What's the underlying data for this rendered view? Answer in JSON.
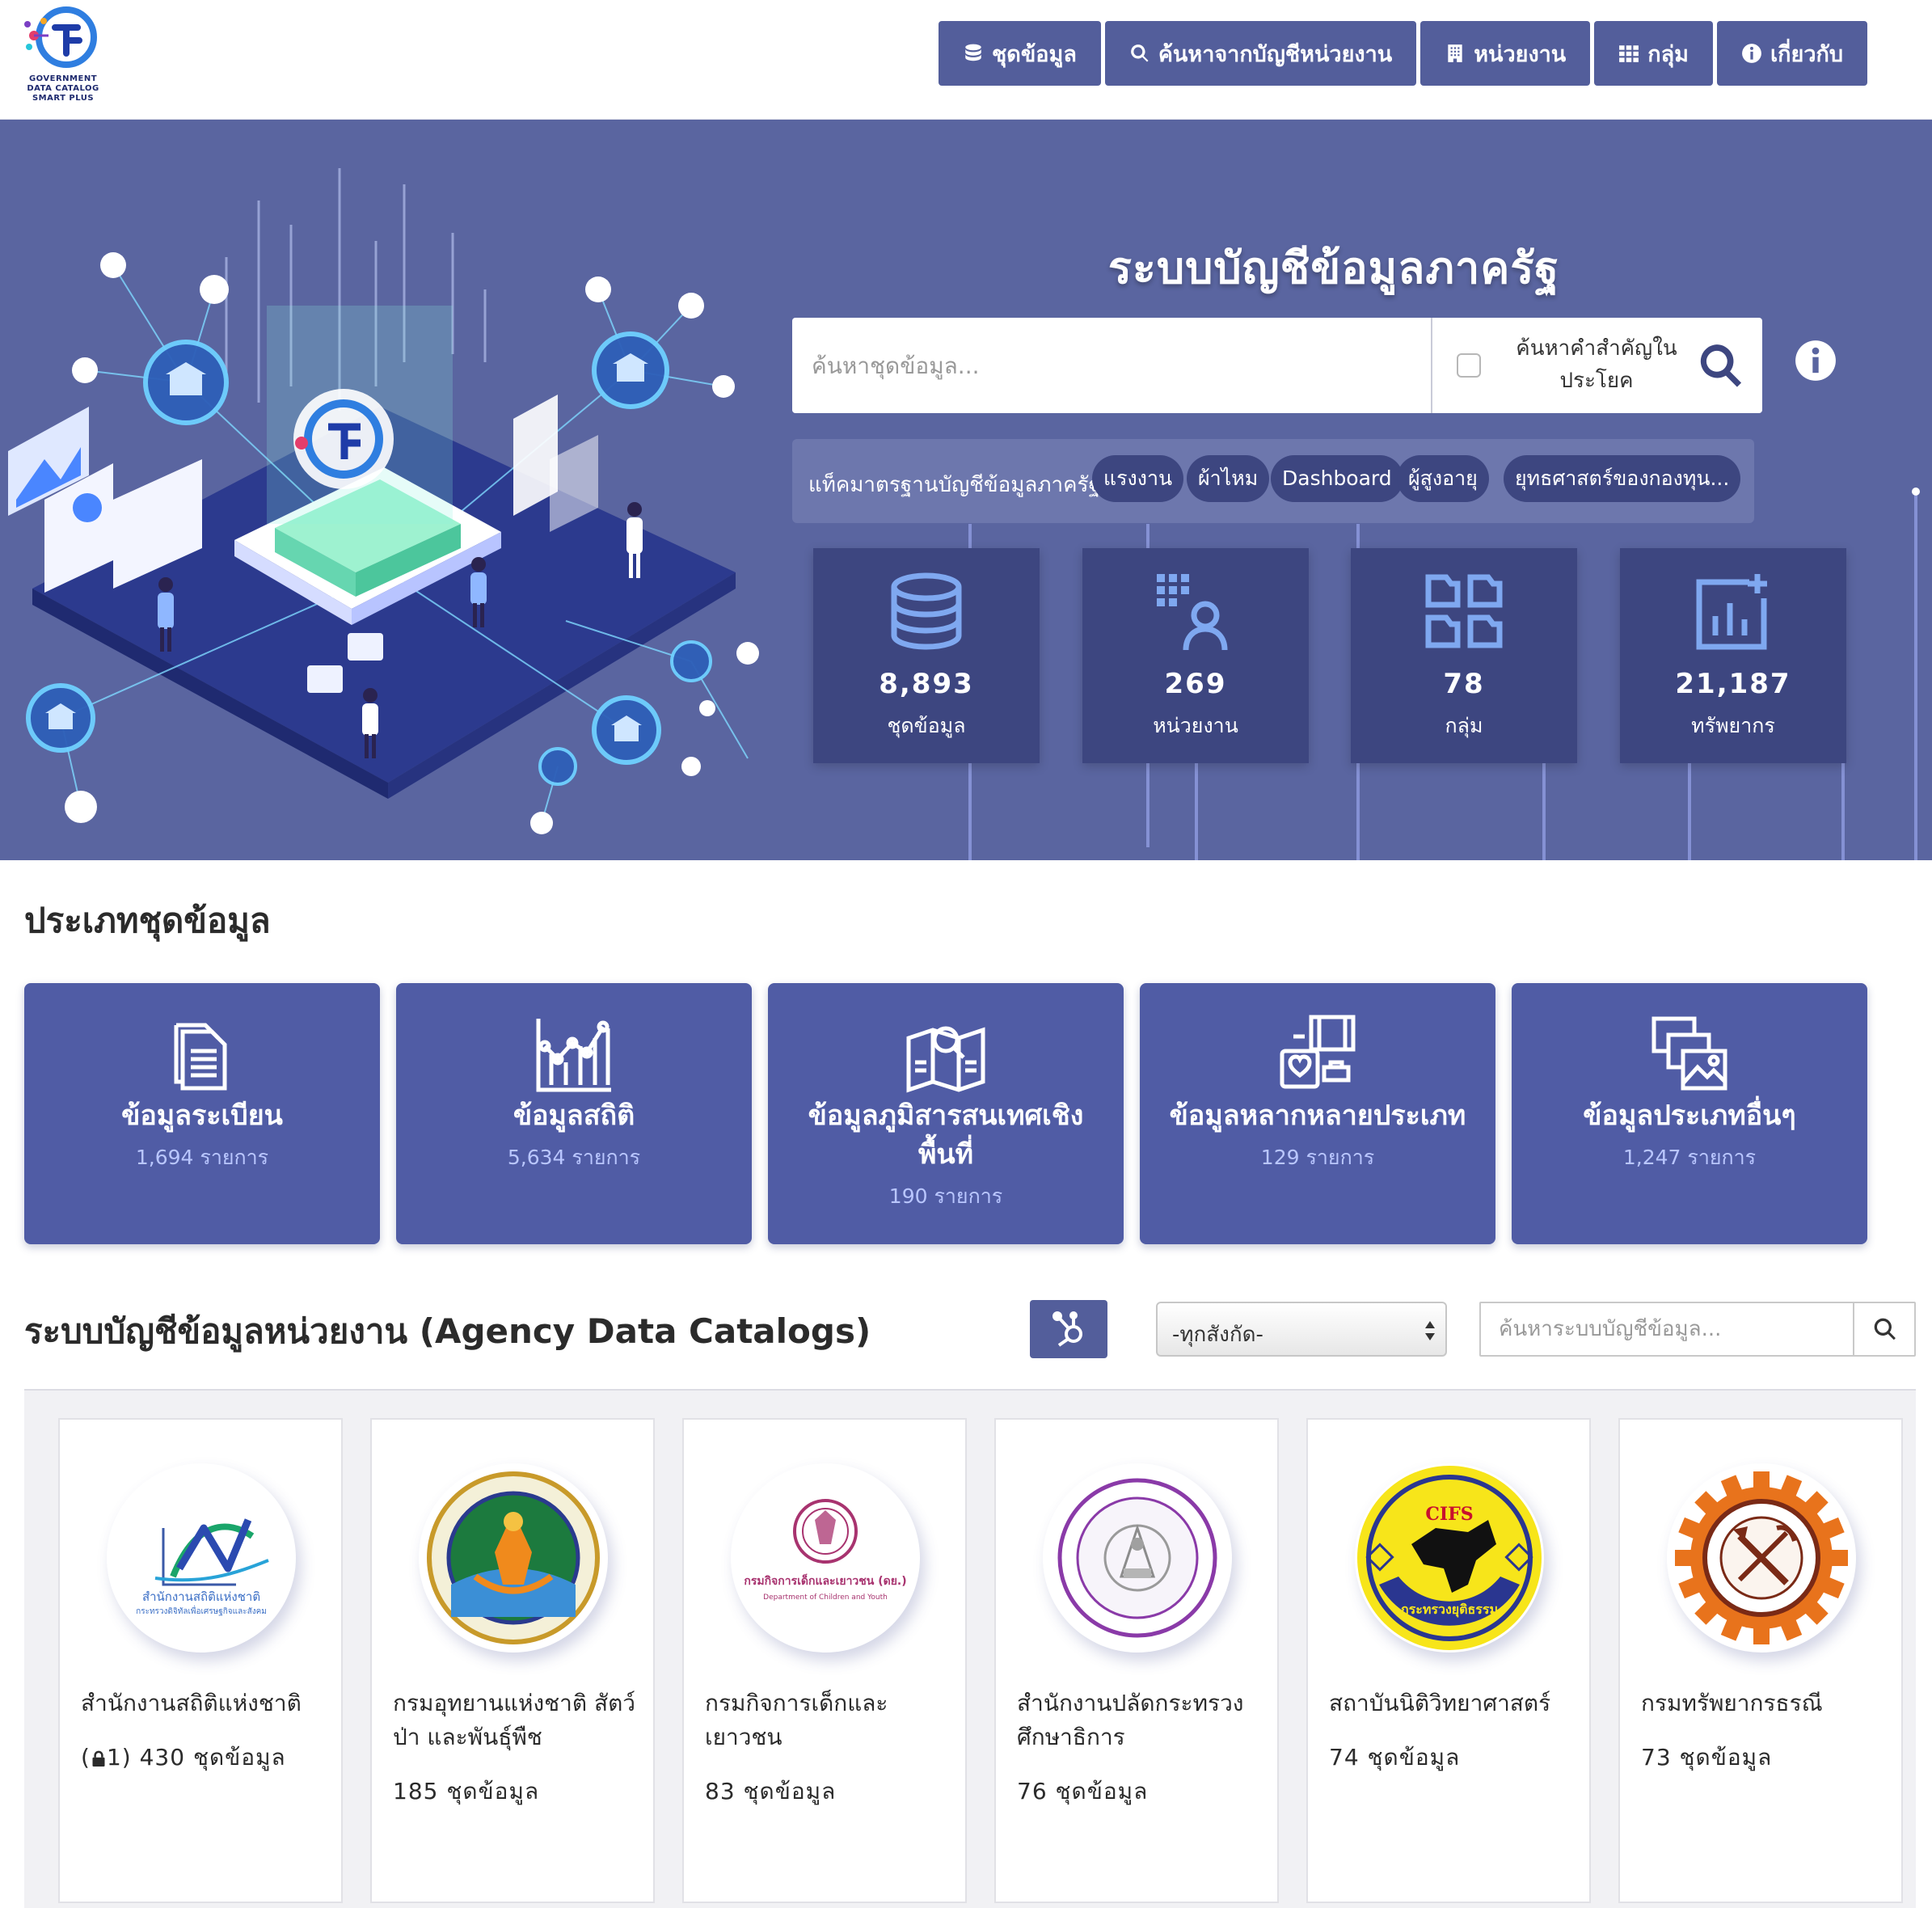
{
  "header": {
    "logo_text": [
      "GOVERNMENT",
      "DATA CATALOG",
      "SMART PLUS"
    ],
    "nav": [
      {
        "label": "ชุดข้อมูล",
        "icon": "database-icon"
      },
      {
        "label": "ค้นหาจากบัญชีหน่วยงาน",
        "icon": "search-icon"
      },
      {
        "label": "หน่วยงาน",
        "icon": "building-icon"
      },
      {
        "label": "กลุ่ม",
        "icon": "grid-icon"
      },
      {
        "label": "เกี่ยวกับ",
        "icon": "info-icon"
      }
    ]
  },
  "hero": {
    "title": "ระบบบัญชีข้อมูลภาครัฐ",
    "search_placeholder": "ค้นหาชุดข้อมูล...",
    "keyword_toggle_label": "ค้นหาคำสำคัญในประโยค",
    "tags_label": "แท็คมาตรฐานบัญชีข้อมูลภาครัฐ :",
    "tags": [
      "แรงงาน",
      "ผ้าไหม",
      "Dashboard",
      "ผู้สูงอายุ",
      "ยุทธศาสตร์ของกองทุน..."
    ],
    "stats": [
      {
        "value": "8,893",
        "label": "ชุดข้อมูล",
        "icon": "database-icon"
      },
      {
        "value": "269",
        "label": "หน่วยงาน",
        "icon": "organization-user-icon"
      },
      {
        "value": "78",
        "label": "กลุ่ม",
        "icon": "group-grid-icon"
      },
      {
        "value": "21,187",
        "label": "ทรัพยากร",
        "icon": "chart-plus-icon"
      }
    ]
  },
  "types": {
    "title": "ประเภทชุดข้อมูล",
    "items": [
      {
        "name": "ข้อมูลระเบียน",
        "count": "1,694 รายการ",
        "icon": "document-stack-icon"
      },
      {
        "name": "ข้อมูลสถิติ",
        "count": "5,634 รายการ",
        "icon": "line-chart-icon"
      },
      {
        "name": "ข้อมูลภูมิสารสนเทศเชิงพื้นที่",
        "count": "190 รายการ",
        "icon": "map-search-icon"
      },
      {
        "name": "ข้อมูลหลากหลายประเภท",
        "count": "129 รายการ",
        "icon": "multimedia-icon"
      },
      {
        "name": "ข้อมูลประเภทอื่นๆ",
        "count": "1,247 รายการ",
        "icon": "image-files-icon"
      }
    ]
  },
  "agency": {
    "title": "ระบบบัญชีข้อมูลหน่วยงาน (Agency Data Catalogs)",
    "filter_value": "-ทุกสังกัด-",
    "search_placeholder": "ค้นหาระบบบัญชีข้อมูล...",
    "logo_texts": {
      "nso_line1": "สำนักงานสถิติแห่งชาติ",
      "nso_line2": "กระทรวงดิจิทัลเพื่อเศรษฐกิจและสังคม",
      "dcy_line1": "กรมกิจการเด็กและเยาวชน (ดย.)",
      "dcy_line2": "Department of Children and Youth",
      "cifs_en": "CIFS",
      "cifs_th": "กระทรวงยุติธรรม"
    },
    "items": [
      {
        "name": "สำนักงานสถิติแห่งชาติ",
        "count": "430 ชุดข้อมูล",
        "locked_prefix": "(",
        "locked_count": "1",
        "locked_suffix": ")"
      },
      {
        "name": "กรมอุทยานแห่งชาติ สัตว์ป่า และพันธุ์พืช",
        "count": "185 ชุดข้อมูล"
      },
      {
        "name": "กรมกิจการเด็กและเยาวชน",
        "count": "83 ชุดข้อมูล"
      },
      {
        "name": "สำนักงานปลัดกระทรวงศึกษาธิการ",
        "count": "76 ชุดข้อมูล"
      },
      {
        "name": "สถาบันนิติวิทยาศาสตร์",
        "count": "74 ชุดข้อมูล"
      },
      {
        "name": "กรมทรัพยากรธรณี",
        "count": "73 ชุดข้อมูล"
      }
    ]
  }
}
